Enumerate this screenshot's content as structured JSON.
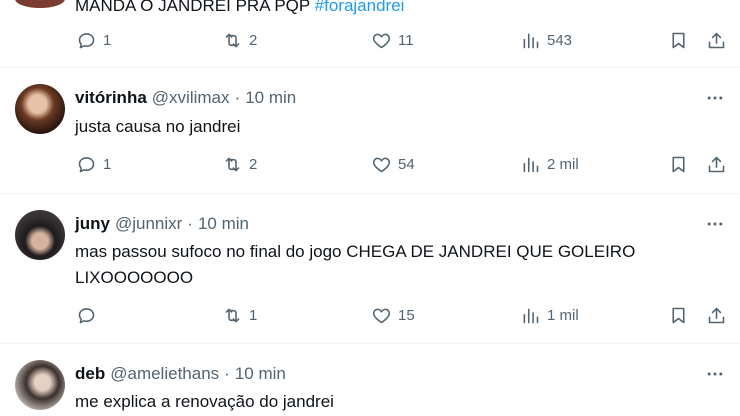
{
  "tweets": [
    {
      "name": "",
      "handle": "",
      "time": "",
      "text": "MANDA O JANDREI PRA PQP",
      "hashtag": "#forajandrei",
      "replies": "1",
      "retweets": "2",
      "likes": "11",
      "views": "543"
    },
    {
      "name": "vitórinha",
      "handle": "@xvilimax",
      "time": "10 min",
      "text": "justa causa no jandrei",
      "replies": "1",
      "retweets": "2",
      "likes": "54",
      "views": "2 mil"
    },
    {
      "name": "juny",
      "handle": "@junnixr",
      "time": "10 min",
      "text": "mas passou sufoco no final do jogo CHEGA DE JANDREI QUE GOLEIRO LIXOOOOOOO",
      "replies": "",
      "retweets": "1",
      "likes": "15",
      "views": "1 mil"
    },
    {
      "name": "deb",
      "handle": "@ameliethans",
      "time": "10 min",
      "text": "me explica a renovação do jandrei"
    }
  ],
  "separator": "·",
  "icons": [
    "reply-icon",
    "retweet-icon",
    "like-icon",
    "views-icon",
    "bookmark-icon",
    "share-icon",
    "more-icon"
  ],
  "colors": {
    "text": "#0f1419",
    "secondary": "#536471",
    "link": "#1d9bf0",
    "divider": "#eff3f4"
  }
}
